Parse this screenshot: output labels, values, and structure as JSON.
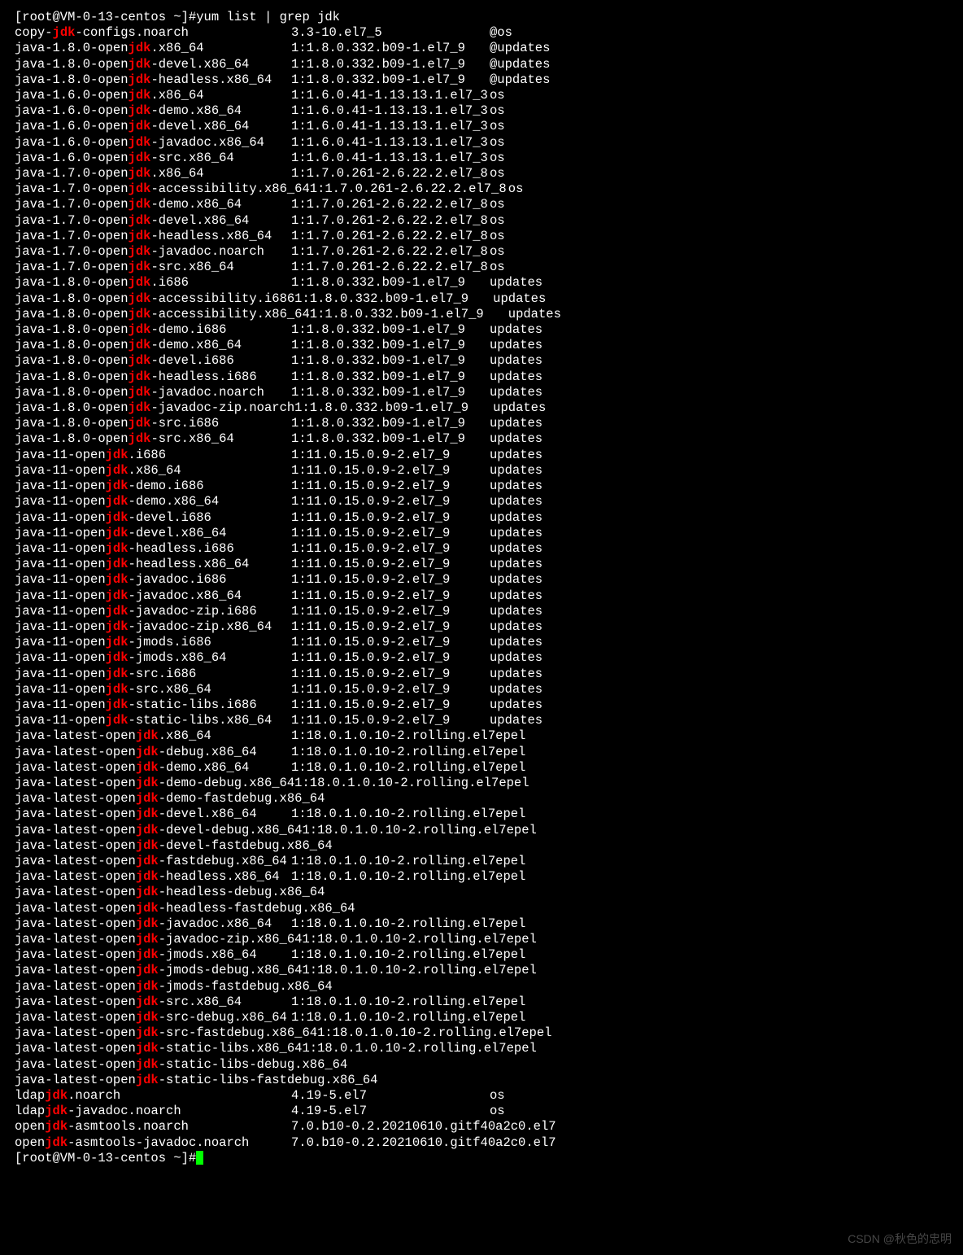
{
  "prompt1": "[root@VM-0-13-centos ~]# ",
  "command": "yum list | grep jdk",
  "prompt2": "[root@VM-0-13-centos ~]# ",
  "watermark": "CSDN @秋色的忠明",
  "rows": [
    {
      "pre": "copy-",
      "hl": "jdk",
      "post": "-configs.noarch",
      "ver": "3.3-10.el7_5",
      "repo": "@os"
    },
    {
      "pre": "java-1.8.0-open",
      "hl": "jdk",
      "post": ".x86_64",
      "ver": "1:1.8.0.332.b09-1.el7_9",
      "repo": "@updates"
    },
    {
      "pre": "java-1.8.0-open",
      "hl": "jdk",
      "post": "-devel.x86_64",
      "ver": "1:1.8.0.332.b09-1.el7_9",
      "repo": "@updates"
    },
    {
      "pre": "java-1.8.0-open",
      "hl": "jdk",
      "post": "-headless.x86_64",
      "ver": "1:1.8.0.332.b09-1.el7_9",
      "repo": "@updates"
    },
    {
      "pre": "java-1.6.0-open",
      "hl": "jdk",
      "post": ".x86_64",
      "ver": "1:1.6.0.41-1.13.13.1.el7_3",
      "repo": "os"
    },
    {
      "pre": "java-1.6.0-open",
      "hl": "jdk",
      "post": "-demo.x86_64",
      "ver": "1:1.6.0.41-1.13.13.1.el7_3",
      "repo": "os"
    },
    {
      "pre": "java-1.6.0-open",
      "hl": "jdk",
      "post": "-devel.x86_64",
      "ver": "1:1.6.0.41-1.13.13.1.el7_3",
      "repo": "os"
    },
    {
      "pre": "java-1.6.0-open",
      "hl": "jdk",
      "post": "-javadoc.x86_64",
      "ver": "1:1.6.0.41-1.13.13.1.el7_3",
      "repo": "os"
    },
    {
      "pre": "java-1.6.0-open",
      "hl": "jdk",
      "post": "-src.x86_64",
      "ver": "1:1.6.0.41-1.13.13.1.el7_3",
      "repo": "os"
    },
    {
      "pre": "java-1.7.0-open",
      "hl": "jdk",
      "post": ".x86_64",
      "ver": "1:1.7.0.261-2.6.22.2.el7_8",
      "repo": "os"
    },
    {
      "pre": "java-1.7.0-open",
      "hl": "jdk",
      "post": "-accessibility.x86_64",
      "ver": "1:1.7.0.261-2.6.22.2.el7_8",
      "repo": "os"
    },
    {
      "pre": "java-1.7.0-open",
      "hl": "jdk",
      "post": "-demo.x86_64",
      "ver": "1:1.7.0.261-2.6.22.2.el7_8",
      "repo": "os"
    },
    {
      "pre": "java-1.7.0-open",
      "hl": "jdk",
      "post": "-devel.x86_64",
      "ver": "1:1.7.0.261-2.6.22.2.el7_8",
      "repo": "os"
    },
    {
      "pre": "java-1.7.0-open",
      "hl": "jdk",
      "post": "-headless.x86_64",
      "ver": "1:1.7.0.261-2.6.22.2.el7_8",
      "repo": "os"
    },
    {
      "pre": "java-1.7.0-open",
      "hl": "jdk",
      "post": "-javadoc.noarch",
      "ver": "1:1.7.0.261-2.6.22.2.el7_8",
      "repo": "os"
    },
    {
      "pre": "java-1.7.0-open",
      "hl": "jdk",
      "post": "-src.x86_64",
      "ver": "1:1.7.0.261-2.6.22.2.el7_8",
      "repo": "os"
    },
    {
      "pre": "java-1.8.0-open",
      "hl": "jdk",
      "post": ".i686",
      "ver": "1:1.8.0.332.b09-1.el7_9",
      "repo": "updates"
    },
    {
      "pre": "java-1.8.0-open",
      "hl": "jdk",
      "post": "-accessibility.i686",
      "ver": "1:1.8.0.332.b09-1.el7_9",
      "repo": "updates"
    },
    {
      "pre": "java-1.8.0-open",
      "hl": "jdk",
      "post": "-accessibility.x86_64",
      "ver": "1:1.8.0.332.b09-1.el7_9",
      "repo": "updates"
    },
    {
      "pre": "java-1.8.0-open",
      "hl": "jdk",
      "post": "-demo.i686",
      "ver": "1:1.8.0.332.b09-1.el7_9",
      "repo": "updates"
    },
    {
      "pre": "java-1.8.0-open",
      "hl": "jdk",
      "post": "-demo.x86_64",
      "ver": "1:1.8.0.332.b09-1.el7_9",
      "repo": "updates"
    },
    {
      "pre": "java-1.8.0-open",
      "hl": "jdk",
      "post": "-devel.i686",
      "ver": "1:1.8.0.332.b09-1.el7_9",
      "repo": "updates"
    },
    {
      "pre": "java-1.8.0-open",
      "hl": "jdk",
      "post": "-headless.i686",
      "ver": "1:1.8.0.332.b09-1.el7_9",
      "repo": "updates"
    },
    {
      "pre": "java-1.8.0-open",
      "hl": "jdk",
      "post": "-javadoc.noarch",
      "ver": "1:1.8.0.332.b09-1.el7_9",
      "repo": "updates"
    },
    {
      "pre": "java-1.8.0-open",
      "hl": "jdk",
      "post": "-javadoc-zip.noarch",
      "ver": "1:1.8.0.332.b09-1.el7_9",
      "repo": "updates"
    },
    {
      "pre": "java-1.8.0-open",
      "hl": "jdk",
      "post": "-src.i686",
      "ver": "1:1.8.0.332.b09-1.el7_9",
      "repo": "updates"
    },
    {
      "pre": "java-1.8.0-open",
      "hl": "jdk",
      "post": "-src.x86_64",
      "ver": "1:1.8.0.332.b09-1.el7_9",
      "repo": "updates"
    },
    {
      "pre": "java-11-open",
      "hl": "jdk",
      "post": ".i686",
      "ver": "1:11.0.15.0.9-2.el7_9",
      "repo": "updates"
    },
    {
      "pre": "java-11-open",
      "hl": "jdk",
      "post": ".x86_64",
      "ver": "1:11.0.15.0.9-2.el7_9",
      "repo": "updates"
    },
    {
      "pre": "java-11-open",
      "hl": "jdk",
      "post": "-demo.i686",
      "ver": "1:11.0.15.0.9-2.el7_9",
      "repo": "updates"
    },
    {
      "pre": "java-11-open",
      "hl": "jdk",
      "post": "-demo.x86_64",
      "ver": "1:11.0.15.0.9-2.el7_9",
      "repo": "updates"
    },
    {
      "pre": "java-11-open",
      "hl": "jdk",
      "post": "-devel.i686",
      "ver": "1:11.0.15.0.9-2.el7_9",
      "repo": "updates"
    },
    {
      "pre": "java-11-open",
      "hl": "jdk",
      "post": "-devel.x86_64",
      "ver": "1:11.0.15.0.9-2.el7_9",
      "repo": "updates"
    },
    {
      "pre": "java-11-open",
      "hl": "jdk",
      "post": "-headless.i686",
      "ver": "1:11.0.15.0.9-2.el7_9",
      "repo": "updates"
    },
    {
      "pre": "java-11-open",
      "hl": "jdk",
      "post": "-headless.x86_64",
      "ver": "1:11.0.15.0.9-2.el7_9",
      "repo": "updates"
    },
    {
      "pre": "java-11-open",
      "hl": "jdk",
      "post": "-javadoc.i686",
      "ver": "1:11.0.15.0.9-2.el7_9",
      "repo": "updates"
    },
    {
      "pre": "java-11-open",
      "hl": "jdk",
      "post": "-javadoc.x86_64",
      "ver": "1:11.0.15.0.9-2.el7_9",
      "repo": "updates"
    },
    {
      "pre": "java-11-open",
      "hl": "jdk",
      "post": "-javadoc-zip.i686",
      "ver": "1:11.0.15.0.9-2.el7_9",
      "repo": "updates"
    },
    {
      "pre": "java-11-open",
      "hl": "jdk",
      "post": "-javadoc-zip.x86_64",
      "ver": "1:11.0.15.0.9-2.el7_9",
      "repo": "updates"
    },
    {
      "pre": "java-11-open",
      "hl": "jdk",
      "post": "-jmods.i686",
      "ver": "1:11.0.15.0.9-2.el7_9",
      "repo": "updates"
    },
    {
      "pre": "java-11-open",
      "hl": "jdk",
      "post": "-jmods.x86_64",
      "ver": "1:11.0.15.0.9-2.el7_9",
      "repo": "updates"
    },
    {
      "pre": "java-11-open",
      "hl": "jdk",
      "post": "-src.i686",
      "ver": "1:11.0.15.0.9-2.el7_9",
      "repo": "updates"
    },
    {
      "pre": "java-11-open",
      "hl": "jdk",
      "post": "-src.x86_64",
      "ver": "1:11.0.15.0.9-2.el7_9",
      "repo": "updates"
    },
    {
      "pre": "java-11-open",
      "hl": "jdk",
      "post": "-static-libs.i686",
      "ver": "1:11.0.15.0.9-2.el7_9",
      "repo": "updates"
    },
    {
      "pre": "java-11-open",
      "hl": "jdk",
      "post": "-static-libs.x86_64",
      "ver": "1:11.0.15.0.9-2.el7_9",
      "repo": "updates"
    },
    {
      "pre": "java-latest-open",
      "hl": "jdk",
      "post": ".x86_64",
      "ver": "1:18.0.1.0.10-2.rolling.el7",
      "repo": "epel"
    },
    {
      "pre": "java-latest-open",
      "hl": "jdk",
      "post": "-debug.x86_64",
      "ver": "1:18.0.1.0.10-2.rolling.el7",
      "repo": "epel"
    },
    {
      "pre": "java-latest-open",
      "hl": "jdk",
      "post": "-demo.x86_64",
      "ver": "1:18.0.1.0.10-2.rolling.el7",
      "repo": "epel"
    },
    {
      "pre": "java-latest-open",
      "hl": "jdk",
      "post": "-demo-debug.x86_64",
      "ver": "1:18.0.1.0.10-2.rolling.el7",
      "repo": "epel"
    },
    {
      "pre": "java-latest-open",
      "hl": "jdk",
      "post": "-demo-fastdebug.x86_64",
      "ver": "",
      "repo": ""
    },
    {
      "pre": "java-latest-open",
      "hl": "jdk",
      "post": "-devel.x86_64",
      "ver": "1:18.0.1.0.10-2.rolling.el7",
      "repo": "epel"
    },
    {
      "pre": "java-latest-open",
      "hl": "jdk",
      "post": "-devel-debug.x86_64",
      "ver": "1:18.0.1.0.10-2.rolling.el7",
      "repo": "epel"
    },
    {
      "pre": "java-latest-open",
      "hl": "jdk",
      "post": "-devel-fastdebug.x86_64",
      "ver": "",
      "repo": ""
    },
    {
      "pre": "java-latest-open",
      "hl": "jdk",
      "post": "-fastdebug.x86_64",
      "ver": "1:18.0.1.0.10-2.rolling.el7",
      "repo": "epel"
    },
    {
      "pre": "java-latest-open",
      "hl": "jdk",
      "post": "-headless.x86_64",
      "ver": "1:18.0.1.0.10-2.rolling.el7",
      "repo": "epel"
    },
    {
      "pre": "java-latest-open",
      "hl": "jdk",
      "post": "-headless-debug.x86_64",
      "ver": "",
      "repo": ""
    },
    {
      "pre": "java-latest-open",
      "hl": "jdk",
      "post": "-headless-fastdebug.x86_64",
      "ver": "",
      "repo": ""
    },
    {
      "pre": "java-latest-open",
      "hl": "jdk",
      "post": "-javadoc.x86_64",
      "ver": "1:18.0.1.0.10-2.rolling.el7",
      "repo": "epel"
    },
    {
      "pre": "java-latest-open",
      "hl": "jdk",
      "post": "-javadoc-zip.x86_64",
      "ver": "1:18.0.1.0.10-2.rolling.el7",
      "repo": "epel"
    },
    {
      "pre": "java-latest-open",
      "hl": "jdk",
      "post": "-jmods.x86_64",
      "ver": "1:18.0.1.0.10-2.rolling.el7",
      "repo": "epel"
    },
    {
      "pre": "java-latest-open",
      "hl": "jdk",
      "post": "-jmods-debug.x86_64",
      "ver": "1:18.0.1.0.10-2.rolling.el7",
      "repo": "epel"
    },
    {
      "pre": "java-latest-open",
      "hl": "jdk",
      "post": "-jmods-fastdebug.x86_64",
      "ver": "",
      "repo": ""
    },
    {
      "pre": "java-latest-open",
      "hl": "jdk",
      "post": "-src.x86_64",
      "ver": "1:18.0.1.0.10-2.rolling.el7",
      "repo": "epel"
    },
    {
      "pre": "java-latest-open",
      "hl": "jdk",
      "post": "-src-debug.x86_64",
      "ver": "1:18.0.1.0.10-2.rolling.el7",
      "repo": "epel"
    },
    {
      "pre": "java-latest-open",
      "hl": "jdk",
      "post": "-src-fastdebug.x86_64",
      "ver": "1:18.0.1.0.10-2.rolling.el7",
      "repo": "epel"
    },
    {
      "pre": "java-latest-open",
      "hl": "jdk",
      "post": "-static-libs.x86_64",
      "ver": "1:18.0.1.0.10-2.rolling.el7",
      "repo": "epel"
    },
    {
      "pre": "java-latest-open",
      "hl": "jdk",
      "post": "-static-libs-debug.x86_64",
      "ver": "",
      "repo": ""
    },
    {
      "pre": "java-latest-open",
      "hl": "jdk",
      "post": "-static-libs-fastdebug.x86_64",
      "ver": "",
      "repo": ""
    },
    {
      "pre": "ldap",
      "hl": "jdk",
      "post": ".noarch",
      "ver": "4.19-5.el7",
      "repo": "os"
    },
    {
      "pre": "ldap",
      "hl": "jdk",
      "post": "-javadoc.noarch",
      "ver": "4.19-5.el7",
      "repo": "os"
    },
    {
      "pre": "open",
      "hl": "jdk",
      "post": "-asmtools.noarch",
      "ver": "7.0.b10-0.2.20210610.gitf40a2c0.el7",
      "repo": ""
    },
    {
      "pre": "open",
      "hl": "jdk",
      "post": "-asmtools-javadoc.noarch",
      "ver": "7.0.b10-0.2.20210610.gitf40a2c0.el7",
      "repo": ""
    }
  ]
}
